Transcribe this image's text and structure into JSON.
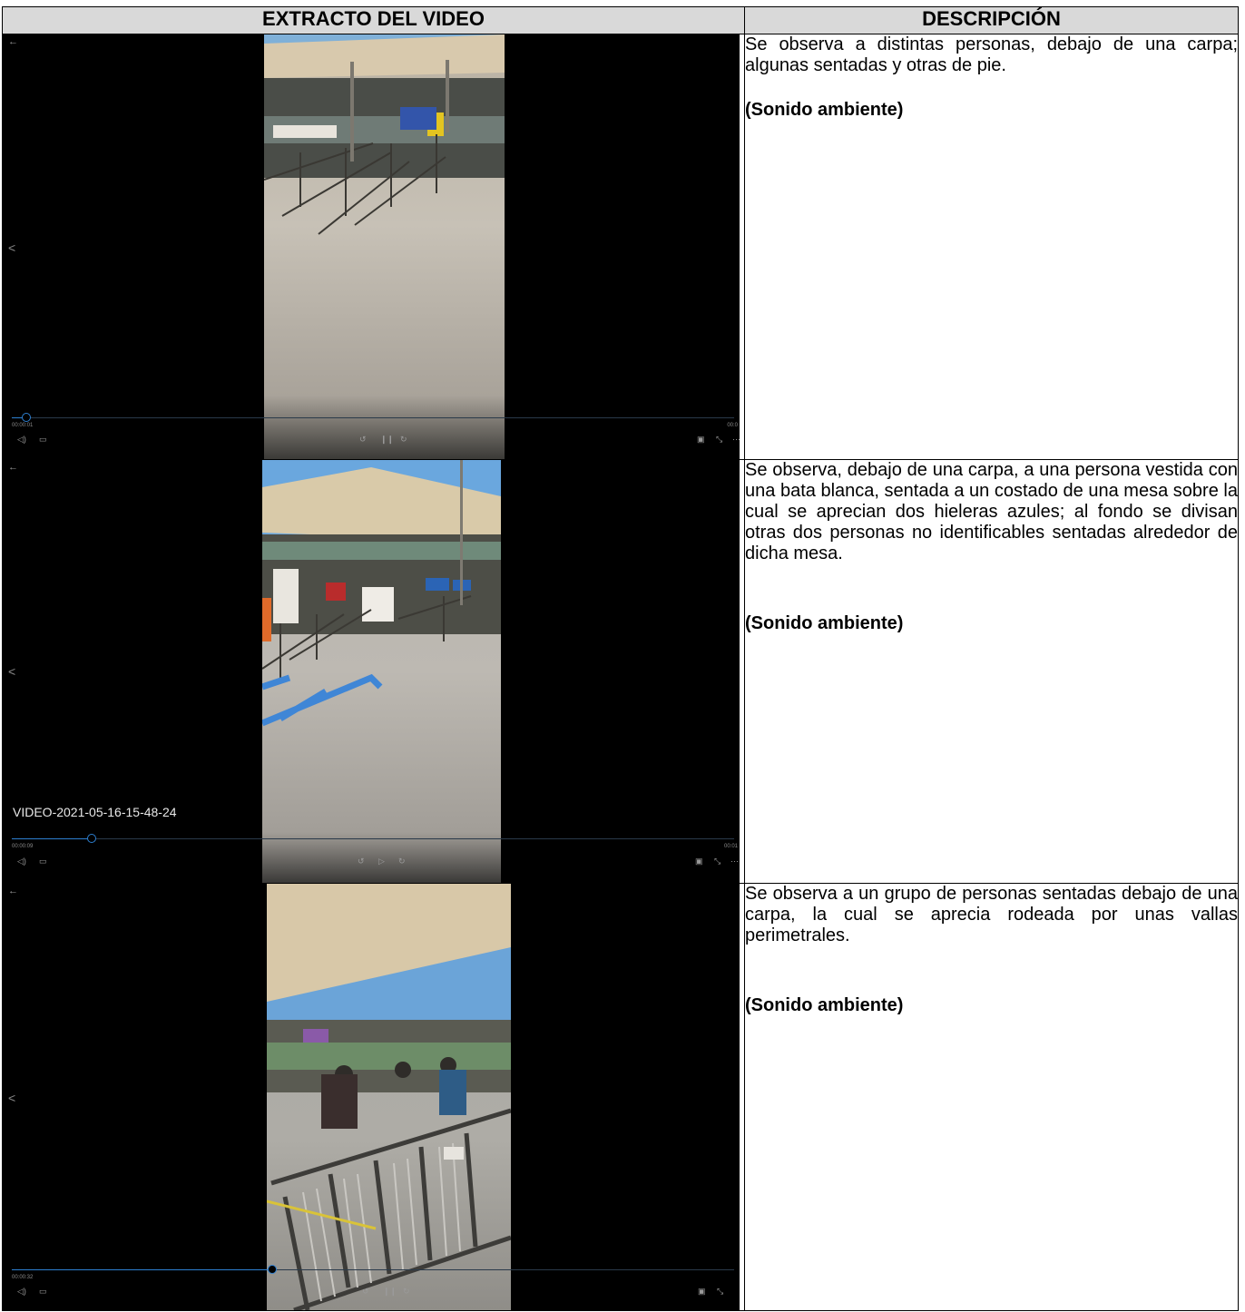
{
  "headers": {
    "video": "EXTRACTO DEL VIDEO",
    "description": "DESCRIPCIÓN"
  },
  "player_icons": [
    "back-arrow-icon",
    "chevron-left-icon",
    "volume-icon",
    "subtitles-icon",
    "rewind-icon",
    "play-pause-icon",
    "forward-icon",
    "miniplayer-icon",
    "fullscreen-icon",
    "more-icon"
  ],
  "rows": [
    {
      "frame": {
        "title": "",
        "elapsed": "00:00:01",
        "total": "00:0",
        "progress": 0.02,
        "state": "pause"
      },
      "paragraph": "Se observa a distintas personas, debajo de una carpa; algunas sentadas y otras de pie.",
      "sound": "(Sonido ambiente)"
    },
    {
      "frame": {
        "title": "VIDEO-2021-05-16-15-48-24",
        "elapsed": "00:00:09",
        "total": "00:01",
        "progress": 0.11,
        "state": "play"
      },
      "paragraph": "Se observa, debajo de una carpa, a una persona vestida con una bata blanca, sentada a un costado de una mesa sobre la cual se aprecian dos hieleras azules; al fondo se divisan otras dos personas no identificables sentadas alrededor de dicha mesa.",
      "sound": "(Sonido ambiente)"
    },
    {
      "frame": {
        "title": "",
        "elapsed": "00:00:32",
        "total": "",
        "progress": 0.36,
        "state": "pause"
      },
      "paragraph": "Se observa a un grupo de personas sentadas debajo de una carpa, la cual se aprecia rodeada por unas vallas perimetrales.",
      "sound": "(Sonido ambiente)"
    }
  ]
}
